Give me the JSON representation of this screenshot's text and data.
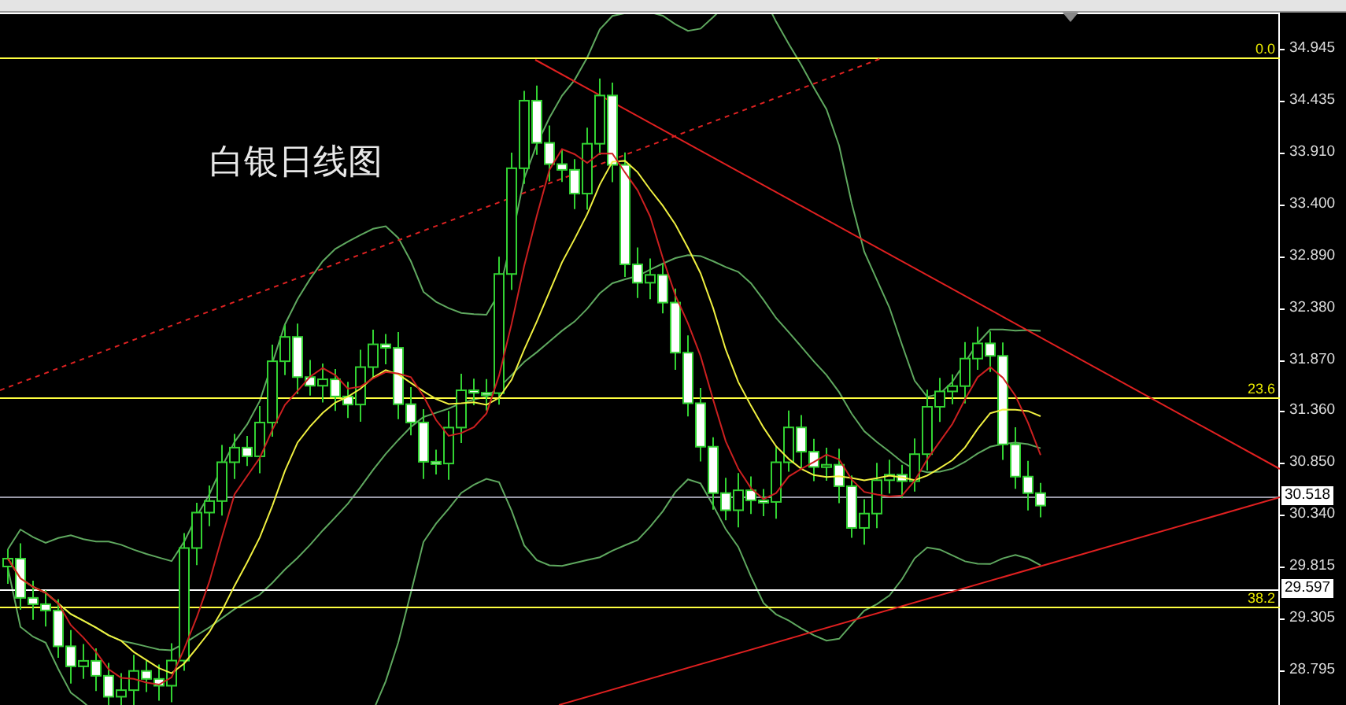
{
  "chart": {
    "title": "白银日线图",
    "fib_labels": [
      "0.0",
      "23.6",
      "38.2"
    ],
    "price_axis": {
      "ticks": [
        "34.945",
        "34.435",
        "33.910",
        "33.400",
        "32.890",
        "32.380",
        "31.870",
        "31.360",
        "30.850",
        "30.340",
        "29.815",
        "29.305",
        "28.795"
      ]
    },
    "price_tags": [
      {
        "kind": "current",
        "label": "30.518"
      },
      {
        "kind": "level",
        "label": "29.597"
      }
    ]
  }
}
